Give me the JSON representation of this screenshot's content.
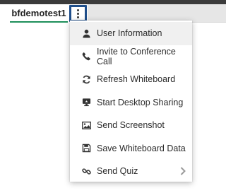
{
  "header": {
    "user_tab_label": "bfdemotest1",
    "more_options_icon": "vertical-ellipsis-icon"
  },
  "menu": {
    "items": [
      {
        "label": "User Information",
        "icon": "user-icon",
        "highlighted": true
      },
      {
        "label": "Invite to Conference Call",
        "icon": "phone-icon",
        "highlighted": false
      },
      {
        "label": "Refresh Whiteboard",
        "icon": "refresh-icon",
        "highlighted": false
      },
      {
        "label": "Start Desktop Sharing",
        "icon": "desktop-share-icon",
        "highlighted": false
      },
      {
        "label": "Send Screenshot",
        "icon": "image-icon",
        "highlighted": false
      },
      {
        "label": "Save Whiteboard Data",
        "icon": "save-icon",
        "highlighted": false
      },
      {
        "label": "Send Quiz",
        "icon": "quiz-link-icon",
        "highlighted": false,
        "has_submenu": true
      }
    ]
  },
  "colors": {
    "active_tab_underline": "#1e8f5a",
    "focus_outline": "#1f4e8a",
    "menu_highlight": "#f0f0f0"
  }
}
